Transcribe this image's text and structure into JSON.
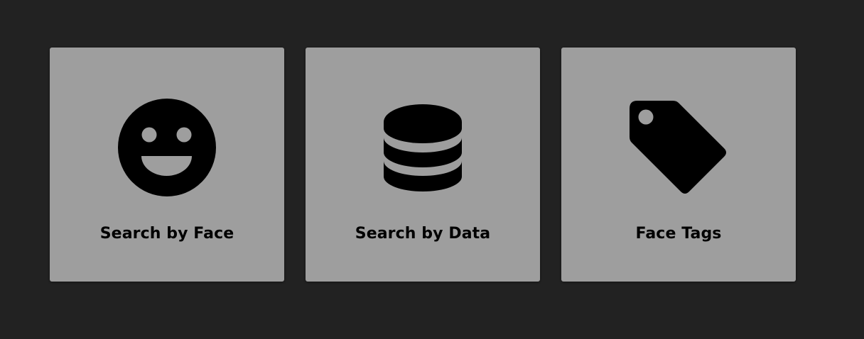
{
  "colors": {
    "background": "#222222",
    "tile": "#9e9e9e",
    "icon": "#000000",
    "text": "#000000"
  },
  "tiles": [
    {
      "label": "Search by Face",
      "icon": "smiley-face-icon"
    },
    {
      "label": "Search by Data",
      "icon": "database-icon"
    },
    {
      "label": "Face Tags",
      "icon": "tag-icon"
    }
  ]
}
